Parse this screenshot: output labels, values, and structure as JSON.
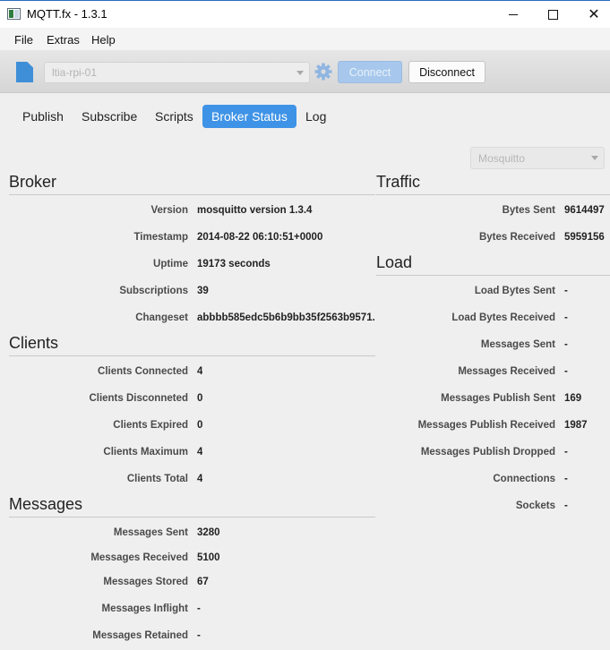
{
  "window": {
    "title": "MQTT.fx - 1.3.1"
  },
  "menu": {
    "file": "File",
    "extras": "Extras",
    "help": "Help"
  },
  "toolbar": {
    "profile_value": "ltia-rpi-01",
    "connect_label": "Connect",
    "disconnect_label": "Disconnect"
  },
  "tabs": [
    "Publish",
    "Subscribe",
    "Scripts",
    "Broker Status",
    "Log"
  ],
  "active_tab": "Broker Status",
  "broker_type": "Mosquitto",
  "broker": {
    "title": "Broker",
    "rows": [
      {
        "label": "Version",
        "value": "mosquitto version 1.3.4"
      },
      {
        "label": "Timestamp",
        "value": "2014-08-22 06:10:51+0000"
      },
      {
        "label": "Uptime",
        "value": "19173 seconds"
      },
      {
        "label": "Subscriptions",
        "value": "39"
      },
      {
        "label": "Changeset",
        "value": "abbbb585edc5b6b9bb35f2563b9571..."
      }
    ]
  },
  "clients": {
    "title": "Clients",
    "rows": [
      {
        "label": "Clients Connected",
        "value": "4"
      },
      {
        "label": "Clients Disconneted",
        "value": "0"
      },
      {
        "label": "Clients Expired",
        "value": "0"
      },
      {
        "label": "Clients Maximum",
        "value": "4"
      },
      {
        "label": "Clients Total",
        "value": "4"
      }
    ]
  },
  "messages": {
    "title": "Messages",
    "rows": [
      {
        "label": "Messages Sent",
        "value": "3280"
      },
      {
        "label": "Messages Received",
        "value": "5100"
      },
      {
        "label": "Messages Stored",
        "value": "67"
      },
      {
        "label": "Messages Inflight",
        "value": "-"
      },
      {
        "label": "Messages Retained",
        "value": "-"
      }
    ]
  },
  "traffic": {
    "title": "Traffic",
    "rows": [
      {
        "label": "Bytes Sent",
        "value": "9614497"
      },
      {
        "label": "Bytes Received",
        "value": "5959156"
      }
    ]
  },
  "load": {
    "title": "Load",
    "rows": [
      {
        "label": "Load Bytes Sent",
        "value": "-"
      },
      {
        "label": "Load Bytes Received",
        "value": "-"
      },
      {
        "label": "Messages Sent",
        "value": "-"
      },
      {
        "label": "Messages Received",
        "value": "-"
      },
      {
        "label": "Messages Publish Sent",
        "value": "169"
      },
      {
        "label": "Messages Publish Received",
        "value": "1987"
      },
      {
        "label": "Messages Publish Dropped",
        "value": "-"
      },
      {
        "label": "Connections",
        "value": "-"
      },
      {
        "label": "Sockets",
        "value": "-"
      }
    ]
  }
}
